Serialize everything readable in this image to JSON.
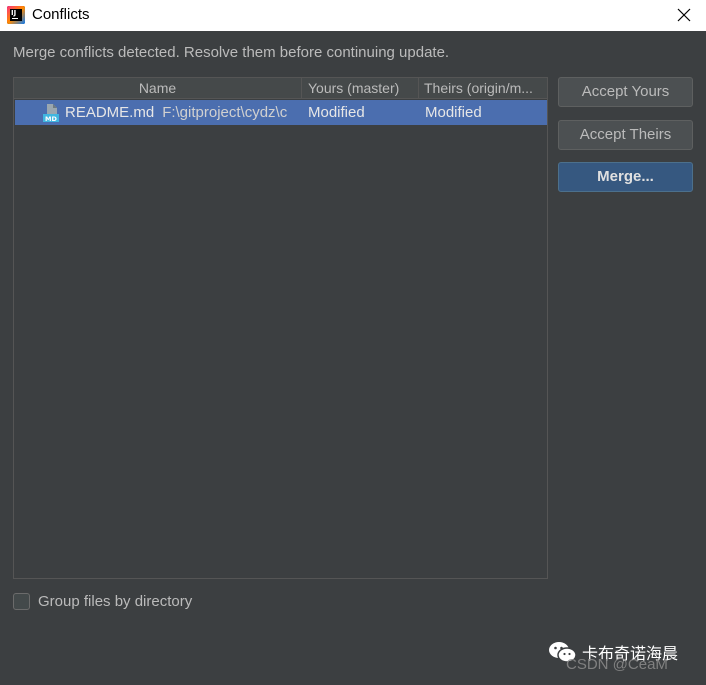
{
  "window": {
    "title": "Conflicts"
  },
  "message": "Merge conflicts detected. Resolve them before continuing update.",
  "table": {
    "columns": [
      "Name",
      "Yours (master)",
      "Theirs (origin/m..."
    ],
    "rows": [
      {
        "name": "README.md",
        "path": "F:\\gitproject\\cydz\\c",
        "yours": "Modified",
        "theirs": "Modified"
      }
    ]
  },
  "buttons": {
    "accept_yours": "Accept Yours",
    "accept_theirs": "Accept Theirs",
    "merge": "Merge..."
  },
  "options": {
    "group_files_label": "Group files by directory",
    "group_files_checked": false
  },
  "watermark": {
    "account": "卡布奇诺海晨",
    "csdn": "CSDN @CeaM"
  },
  "colors": {
    "background": "#3c3f41",
    "selection": "#4b6eaf",
    "default_button": "#365880"
  },
  "icons": {
    "app": "intellij-idea-icon",
    "close": "close-icon",
    "file": "markdown-file-icon",
    "watermark": "wechat-icon"
  }
}
